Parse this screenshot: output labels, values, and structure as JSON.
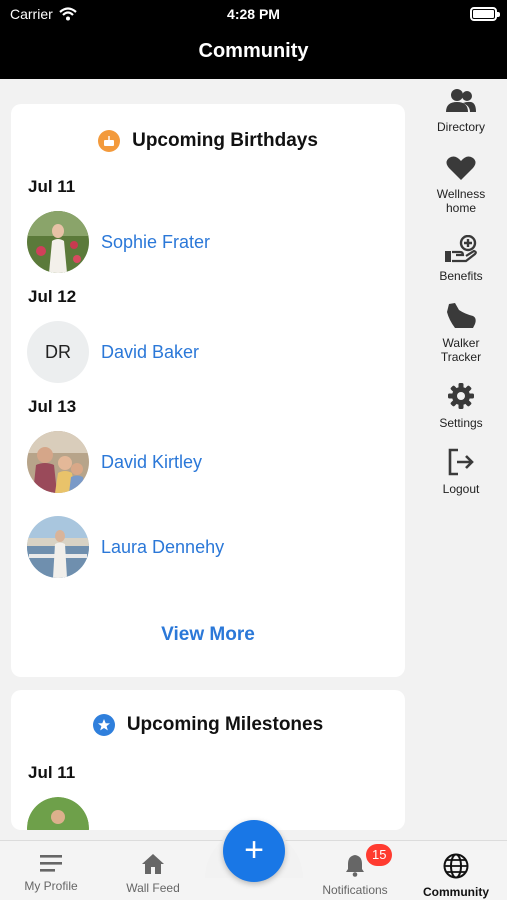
{
  "status_bar": {
    "carrier": "Carrier",
    "time": "4:28 PM"
  },
  "nav": {
    "title": "Community"
  },
  "birthdays": {
    "title": "Upcoming Birthdays",
    "groups": [
      {
        "date": "Jul 11",
        "people": [
          {
            "name": "Sophie Frater",
            "avatar": "photo"
          }
        ]
      },
      {
        "date": "Jul 12",
        "people": [
          {
            "name": "David Baker",
            "avatar": "initials",
            "initials": "DR"
          }
        ]
      },
      {
        "date": "Jul 13",
        "people": [
          {
            "name": "David Kirtley",
            "avatar": "photo"
          },
          {
            "name": "Laura Dennehy",
            "avatar": "photo"
          }
        ]
      }
    ],
    "view_more": "View More"
  },
  "milestones": {
    "title": "Upcoming Milestones",
    "groups": [
      {
        "date": "Jul 11"
      }
    ]
  },
  "side_menu": [
    {
      "label": "Directory",
      "icon": "people-icon"
    },
    {
      "label": "Wellness home",
      "icon": "heart-icon"
    },
    {
      "label": "Benefits",
      "icon": "benefits-hand-icon"
    },
    {
      "label": "Walker Tracker",
      "icon": "shoe-icon"
    },
    {
      "label": "Settings",
      "icon": "gear-icon"
    },
    {
      "label": "Logout",
      "icon": "logout-icon"
    }
  ],
  "tabbar": {
    "tabs": [
      {
        "label": "My Profile",
        "icon": "menu-icon"
      },
      {
        "label": "Wall Feed",
        "icon": "home-icon"
      },
      {
        "label": "Notifications",
        "icon": "bell-icon",
        "badge": "15"
      },
      {
        "label": "Community",
        "icon": "globe-icon",
        "active": true
      }
    ],
    "fab_label": "+"
  },
  "colors": {
    "accent": "#2b78d8",
    "fab": "#1977e6",
    "badge": "#ff3b30",
    "birthday_icon": "#f39a3c",
    "milestone_icon": "#2f7fdc"
  }
}
